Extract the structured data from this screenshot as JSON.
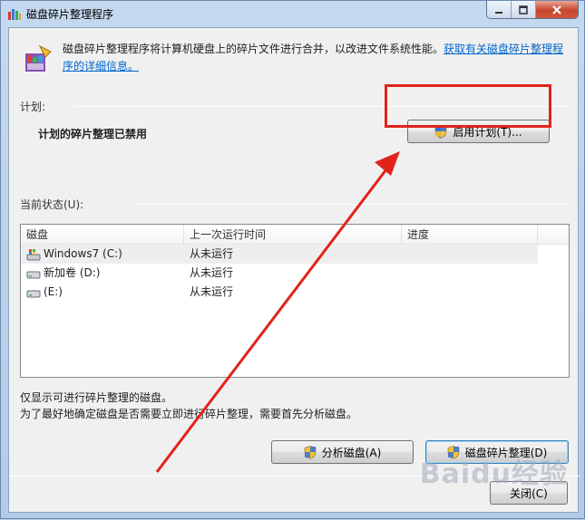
{
  "window": {
    "title": "磁盘碎片整理程序"
  },
  "description": {
    "text": "磁盘碎片整理程序将计算机硬盘上的碎片文件进行合并，以改进文件系统性能。",
    "link": "获取有关磁盘碎片整理程序的详细信息。"
  },
  "schedule": {
    "section_label": "计划:",
    "status": "计划的碎片整理已禁用",
    "enable_button": "启用计划(T)..."
  },
  "current_status": {
    "section_label": "当前状态(U):",
    "columns": [
      "磁盘",
      "上一次运行时间",
      "进度"
    ],
    "rows": [
      {
        "disk": "Windows7 (C:)",
        "last_run": "从未运行",
        "progress": "",
        "icon": "system-drive-icon"
      },
      {
        "disk": "新加卷 (D:)",
        "last_run": "从未运行",
        "progress": "",
        "icon": "hard-drive-icon"
      },
      {
        "disk": "(E:)",
        "last_run": "从未运行",
        "progress": "",
        "icon": "hard-drive-icon"
      }
    ]
  },
  "notes": {
    "line1": "仅显示可进行碎片整理的磁盘。",
    "line2": "为了最好地确定磁盘是否需要立即进行碎片整理，需要首先分析磁盘。"
  },
  "buttons": {
    "analyze": "分析磁盘(A)",
    "defrag": "磁盘碎片整理(D)",
    "close": "关闭(C)"
  },
  "colors": {
    "annotation": "#e2231a",
    "link": "#0066cc"
  }
}
